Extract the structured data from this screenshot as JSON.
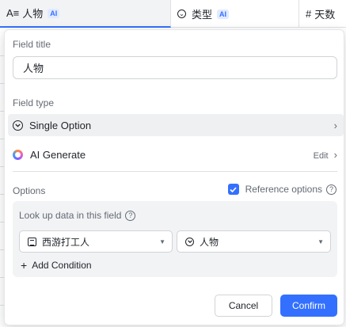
{
  "columns": [
    {
      "icon": "text-field-icon",
      "icon_glyph": "A≡",
      "label": "人物",
      "ai_badge": "AI"
    },
    {
      "icon": "single-option-icon",
      "icon_glyph": "⌄",
      "label": "类型",
      "ai_badge": "AI"
    },
    {
      "icon": "number-icon",
      "icon_glyph": "#",
      "label": "天数"
    }
  ],
  "panel": {
    "field_title_label": "Field title",
    "field_title_value": "人物",
    "field_type_label": "Field type",
    "field_type_value": "Single Option",
    "ai_generate_label": "AI Generate",
    "edit_label": "Edit",
    "options_label": "Options",
    "reference_options_label": "Reference options",
    "reference_options_checked": true,
    "lookup_title": "Look up data in this field",
    "lookup_table_value": "西游打工人",
    "lookup_field_value": "人物",
    "add_condition_label": "Add Condition",
    "cancel_label": "Cancel",
    "confirm_label": "Confirm"
  },
  "colors": {
    "accent": "#3370ff",
    "selected_row": "#eff0f1",
    "lookup_bg": "#f2f3f5"
  }
}
